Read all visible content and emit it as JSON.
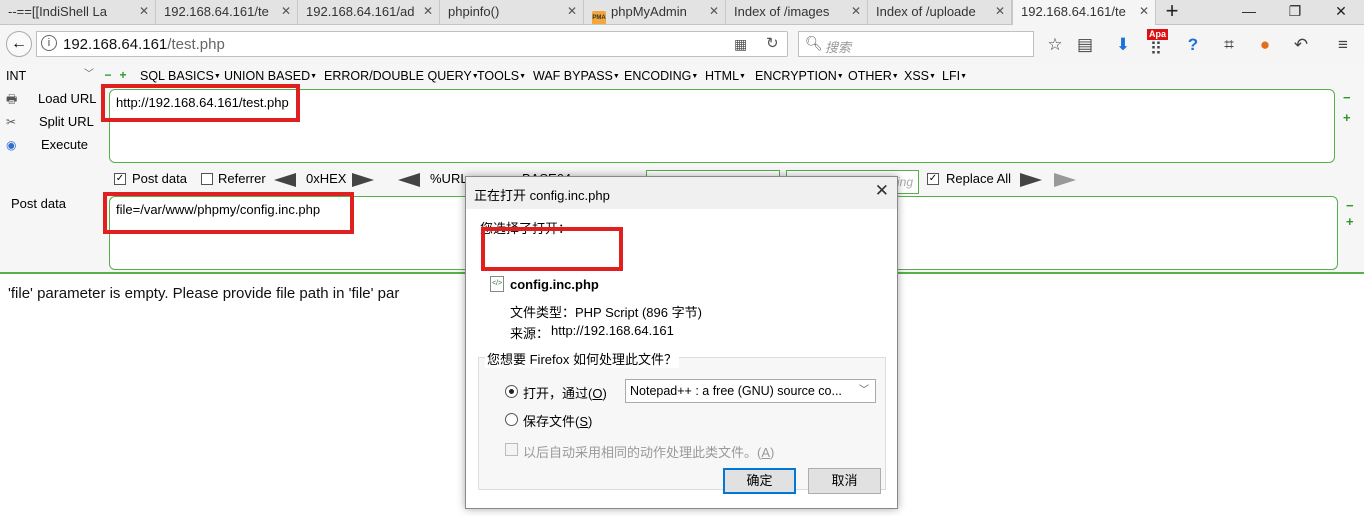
{
  "tabs": [
    {
      "label": "--==[[IndiShell La"
    },
    {
      "label": "192.168.64.161/te"
    },
    {
      "label": "192.168.64.161/ad"
    },
    {
      "label": "phpinfo()"
    },
    {
      "label": "phpMyAdmin",
      "favicon": "PMA"
    },
    {
      "label": "Index of /images"
    },
    {
      "label": "Index of /uploade"
    },
    {
      "label": "192.168.64.161/te"
    }
  ],
  "nav": {
    "url_domain": "192.168.64.161",
    "url_path": "/test.php",
    "search_placeholder": "搜索",
    "badge": "Apa"
  },
  "hackbar": {
    "type_select": "INT",
    "menu": [
      "SQL BASICS",
      "UNION BASED",
      "ERROR/DOUBLE QUERY",
      "TOOLS",
      "WAF BYPASS",
      "ENCODING",
      "HTML",
      "ENCRYPTION",
      "OTHER",
      "XSS",
      "LFI"
    ],
    "load_url": "Load URL",
    "split_url": "Split URL",
    "execute": "Execute",
    "url_value": "http://192.168.64.161/test.php",
    "opt_post": "Post data",
    "opt_referrer": "Referrer",
    "opt_hex": "0xHEX",
    "opt_url": "%URL",
    "opt_base64": "BASE64",
    "opt_replace_all": "Replace All",
    "field2_placeholder": "ing",
    "post_label": "Post data",
    "post_value": "file=/var/www/phpmy/config.inc.php"
  },
  "page": {
    "message": "'file' parameter is empty. Please provide file path in 'file' par"
  },
  "dialog": {
    "title": "正在打开 config.inc.php",
    "chosen": "您选择了打开：",
    "filename": "config.inc.php",
    "type_label": "文件类型：",
    "type_value": "PHP Script (896 字节)",
    "source_label": "来源：",
    "source_value": "http://192.168.64.161",
    "question": "您想要 Firefox 如何处理此文件？",
    "open_with": "打开，通过",
    "open_key": "O",
    "app": "Notepad++ : a free (GNU) source co...",
    "save_file": "保存文件",
    "save_key": "S",
    "auto": "以后自动采用相同的动作处理此类文件。",
    "auto_key": "A",
    "ok": "确定",
    "cancel": "取消"
  }
}
